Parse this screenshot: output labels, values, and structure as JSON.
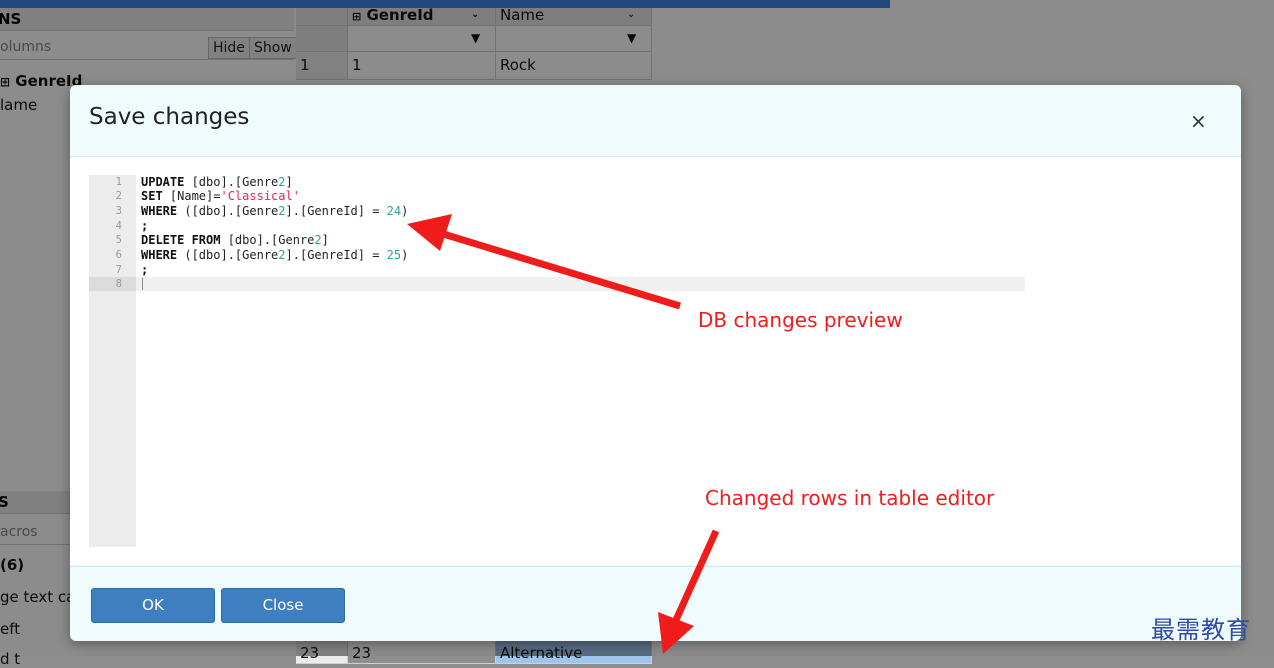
{
  "background_app": {
    "columns_panel": {
      "header": "NS",
      "filter_placeholder": "olumns",
      "hide_label": "Hide",
      "show_label": "Show",
      "items": [
        "GenreId",
        "lame"
      ]
    },
    "macros_panel": {
      "header": "S",
      "filter_placeholder": "acros",
      "items": [
        "(6)",
        "ge text ca",
        "eft",
        "d t"
      ]
    },
    "grid": {
      "col1_header": "GenreId",
      "col2_header": "Name",
      "rows": [
        {
          "num": "1",
          "id": "1",
          "name": "Rock"
        },
        {
          "num": "23",
          "id": "23",
          "name": "Alternative"
        }
      ]
    }
  },
  "modal": {
    "title": "Save changes",
    "close_label": "×",
    "ok_label": "OK",
    "close_button_label": "Close",
    "line_numbers": [
      "1",
      "2",
      "3",
      "4",
      "5",
      "6",
      "7",
      "8"
    ],
    "sql": [
      {
        "kw": "UPDATE",
        "rest_a": " [dbo].[Genre",
        "hl": "2",
        "rest_b": "]"
      },
      {
        "kw": "SET",
        "rest_a": " [Name]=",
        "str": "'Classical'"
      },
      {
        "kw": "WHERE",
        "rest_a": " ([dbo].[Genre",
        "hl": "2",
        "rest_b": "].[GenreId] = ",
        "num": "24",
        "tail": ")"
      },
      {
        "plain": ";"
      },
      {
        "kw": "DELETE FROM",
        "rest_a": " [dbo].[Genre",
        "hl": "2",
        "rest_b": "]"
      },
      {
        "kw": "WHERE",
        "rest_a": " ([dbo].[Genre",
        "hl": "2",
        "rest_b": "].[GenreId] = ",
        "num": "25",
        "tail": ")"
      },
      {
        "plain": ";"
      }
    ]
  },
  "annotations": {
    "preview": "DB changes preview",
    "changed_rows": "Changed rows in table editor",
    "color": "#f01c1c"
  },
  "watermark": "最需教育"
}
